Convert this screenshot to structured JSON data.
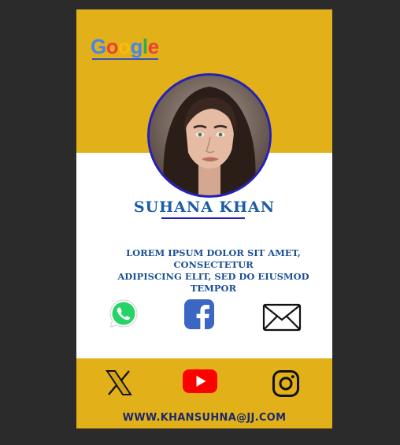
{
  "card": {
    "brand": {
      "letters": [
        {
          "char": "G",
          "color": "#4285F4"
        },
        {
          "char": "o",
          "color": "#EA4335"
        },
        {
          "char": "o",
          "color": "#FBBC05"
        },
        {
          "char": "g",
          "color": "#4285F4"
        },
        {
          "char": "l",
          "color": "#34A853"
        },
        {
          "char": "e",
          "color": "#EA4335"
        }
      ]
    },
    "name": "SUHANA KHAN",
    "bio_line1": "LOREM IPSUM DOLOR SIT AMET, CONSECTETUR",
    "bio_line2": "ADIPISCING ELIT, SED DO EIUSMOD TEMPOR",
    "website": "WWW.KHANSUHNA@JJ.COM",
    "colors": {
      "accent_yellow": "#e2b018",
      "ring_blue": "#2520b8",
      "name_blue": "#1b5ca8"
    },
    "contact_icons": [
      "whatsapp-icon",
      "facebook-icon",
      "mail-icon"
    ],
    "social_icons": [
      "x-icon",
      "youtube-icon",
      "instagram-icon"
    ]
  }
}
